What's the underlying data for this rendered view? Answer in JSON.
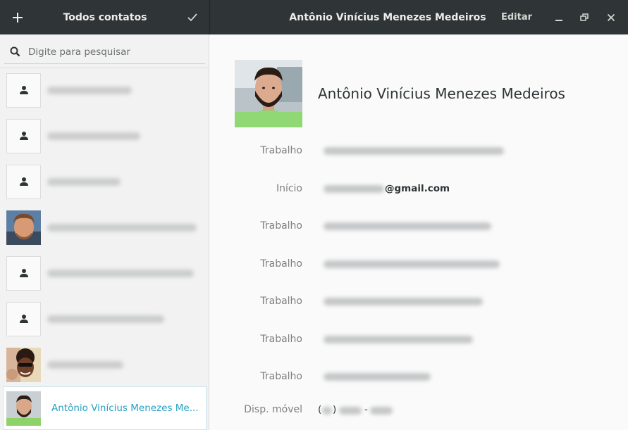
{
  "header": {
    "left_title": "Todos contatos",
    "right_title": "Antônio Vinícius Menezes Medeiros",
    "edit_label": "Editar",
    "add_icon": "plus-icon",
    "select_icon": "checkmark-icon",
    "minimize_icon": "minimize-icon",
    "maximize_icon": "restore-icon",
    "close_icon": "close-icon"
  },
  "search": {
    "placeholder": "Digite para pesquisar",
    "value": ""
  },
  "contacts": [
    {
      "avatar": "default-person-icon",
      "name_redacted": true
    },
    {
      "avatar": "default-person-icon",
      "name_redacted": true
    },
    {
      "avatar": "default-person-icon",
      "name_redacted": true
    },
    {
      "avatar": "photo",
      "name_redacted": true
    },
    {
      "avatar": "default-person-icon",
      "name_redacted": true
    },
    {
      "avatar": "default-person-icon",
      "name_redacted": true
    },
    {
      "avatar": "photo",
      "name_redacted": true
    },
    {
      "avatar": "photo",
      "name": "Antônio Vinícius Menezes Me...",
      "selected": true
    }
  ],
  "detail": {
    "name": "Antônio Vinícius Menezes Medeiros",
    "fields": [
      {
        "label": "Trabalho",
        "value_redacted": true
      },
      {
        "label": "Início",
        "value_suffix": "@gmail.com"
      },
      {
        "label": "Trabalho",
        "value_redacted": true
      },
      {
        "label": "Trabalho",
        "value_redacted": true
      },
      {
        "label": "Trabalho",
        "value_redacted": true
      },
      {
        "label": "Trabalho",
        "value_redacted": true
      },
      {
        "label": "Trabalho",
        "value_redacted": true
      },
      {
        "label": "Disp. móvel",
        "value_open_paren": "(",
        "value_close_paren": ")",
        "value_dash": "-"
      }
    ]
  },
  "colors": {
    "headerbar": "#2f3436",
    "selected_text": "#29a1c2",
    "sidebar_bg": "#f2f2f2",
    "detail_bg": "#fafafa"
  }
}
